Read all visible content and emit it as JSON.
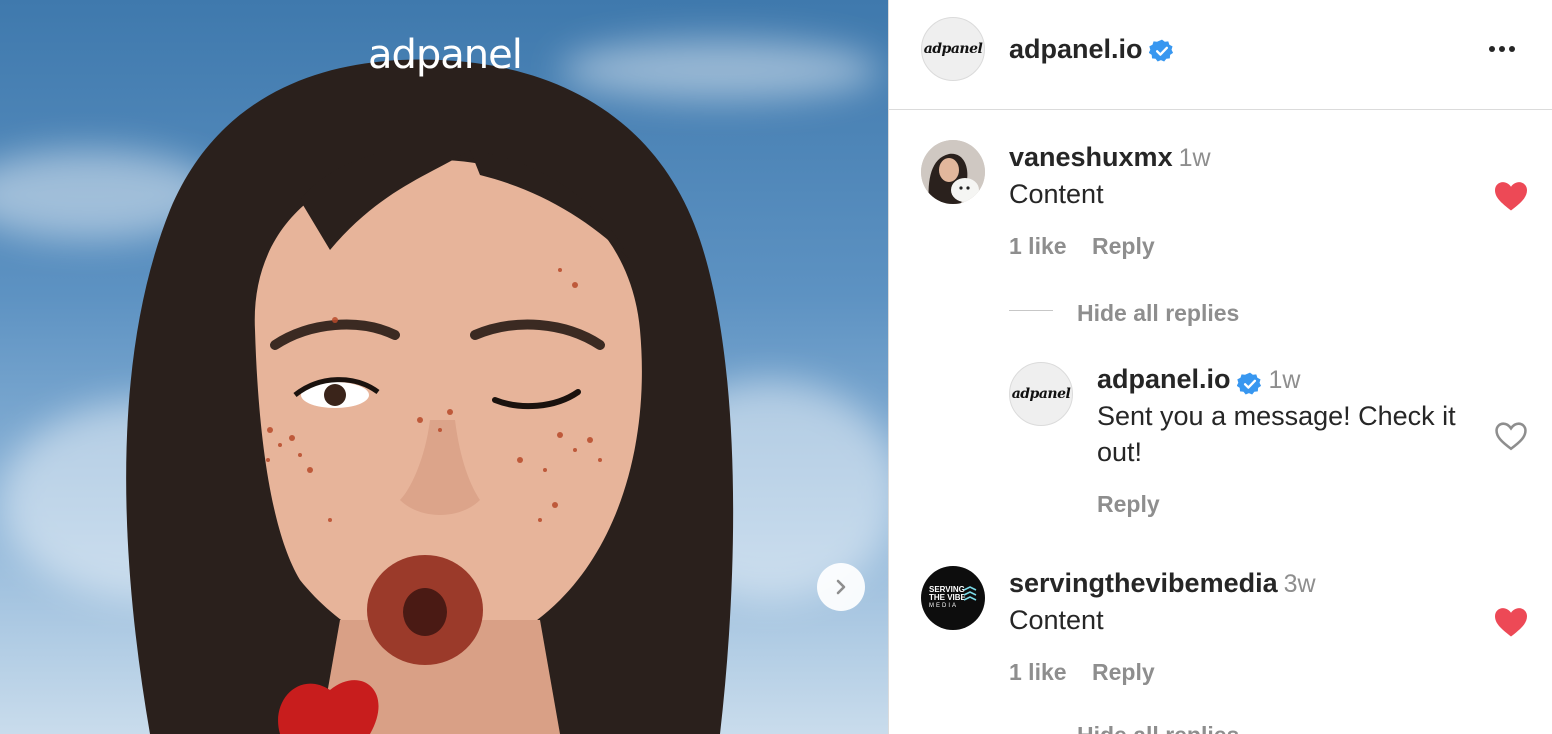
{
  "media": {
    "brand_text": "adpanel"
  },
  "header": {
    "avatar_logo": "adpanel",
    "username": "adpanel.io"
  },
  "comments": [
    {
      "username": "vaneshuxmx",
      "time": "1w",
      "text": "Content",
      "likes": "1 like",
      "reply": "Reply",
      "liked": true,
      "toggle_replies": "Hide all replies",
      "replies": [
        {
          "avatar_logo": "adpanel",
          "username": "adpanel.io",
          "time": "1w",
          "text_line1": "Sent you a message! Check it",
          "text_line2": "out!",
          "reply": "Reply",
          "liked": false
        }
      ]
    },
    {
      "username": "servingthevibemedia",
      "avatar_text_1": "SERVING",
      "avatar_text_2": "THE VIBE",
      "avatar_text_3": "MEDIA",
      "time": "3w",
      "text": "Content",
      "likes": "1 like",
      "reply": "Reply",
      "liked": true,
      "toggle_replies": "Hide all replies"
    }
  ],
  "colors": {
    "liked_heart": "#ed4956",
    "verified_badge": "#3897f0",
    "secondary_text": "#8e8e8e"
  }
}
